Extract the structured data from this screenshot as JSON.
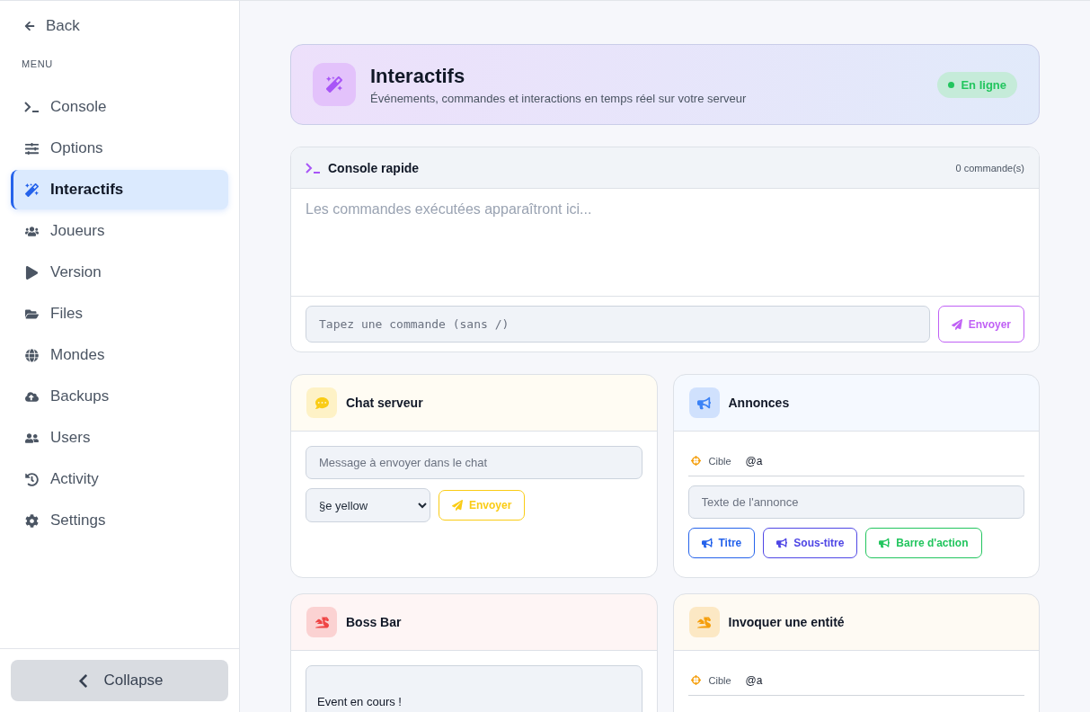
{
  "sidebar": {
    "back": "Back",
    "menu_label": "MENU",
    "items": [
      {
        "label": "Console",
        "selected": false
      },
      {
        "label": "Options",
        "selected": false
      },
      {
        "label": "Interactifs",
        "selected": true
      },
      {
        "label": "Joueurs",
        "selected": false
      },
      {
        "label": "Version",
        "selected": false
      },
      {
        "label": "Files",
        "selected": false
      },
      {
        "label": "Mondes",
        "selected": false
      },
      {
        "label": "Backups",
        "selected": false
      },
      {
        "label": "Users",
        "selected": false
      },
      {
        "label": "Activity",
        "selected": false
      },
      {
        "label": "Settings",
        "selected": false
      }
    ],
    "collapse": "Collapse"
  },
  "header": {
    "title": "Interactifs",
    "subtitle": "Événements, commandes et interactions en temps réel sur votre serveur",
    "status": "En ligne"
  },
  "console": {
    "title": "Console rapide",
    "count": "0 commande(s)",
    "output_placeholder": "Les commandes exécutées apparaîtront ici...",
    "input_placeholder": "Tapez une commande (sans /)",
    "send": "Envoyer"
  },
  "cards": [
    {
      "kind": "chat",
      "title": "Chat serveur",
      "color": "#facc15",
      "placeholder": "Message à envoyer dans le chat",
      "select_value": "§e yellow",
      "send": "Envoyer"
    },
    {
      "kind": "announce",
      "title": "Annonces",
      "color": "#3b82f6",
      "target_label": "Cible",
      "target_value": "@a",
      "placeholder": "Texte de l'annonce",
      "buttons": [
        {
          "label": "Titre",
          "color": "#2563eb"
        },
        {
          "label": "Sous-titre",
          "color": "#4f46e5"
        },
        {
          "label": "Barre d'action",
          "color": "#22c55e"
        }
      ]
    },
    {
      "kind": "bossbar",
      "title": "Boss Bar",
      "color": "#ef4444",
      "value": "Event en cours !"
    },
    {
      "kind": "summon",
      "title": "Invoquer une entité",
      "color": "#f59e0b",
      "target_label": "Cible",
      "target_value": "@a"
    }
  ]
}
